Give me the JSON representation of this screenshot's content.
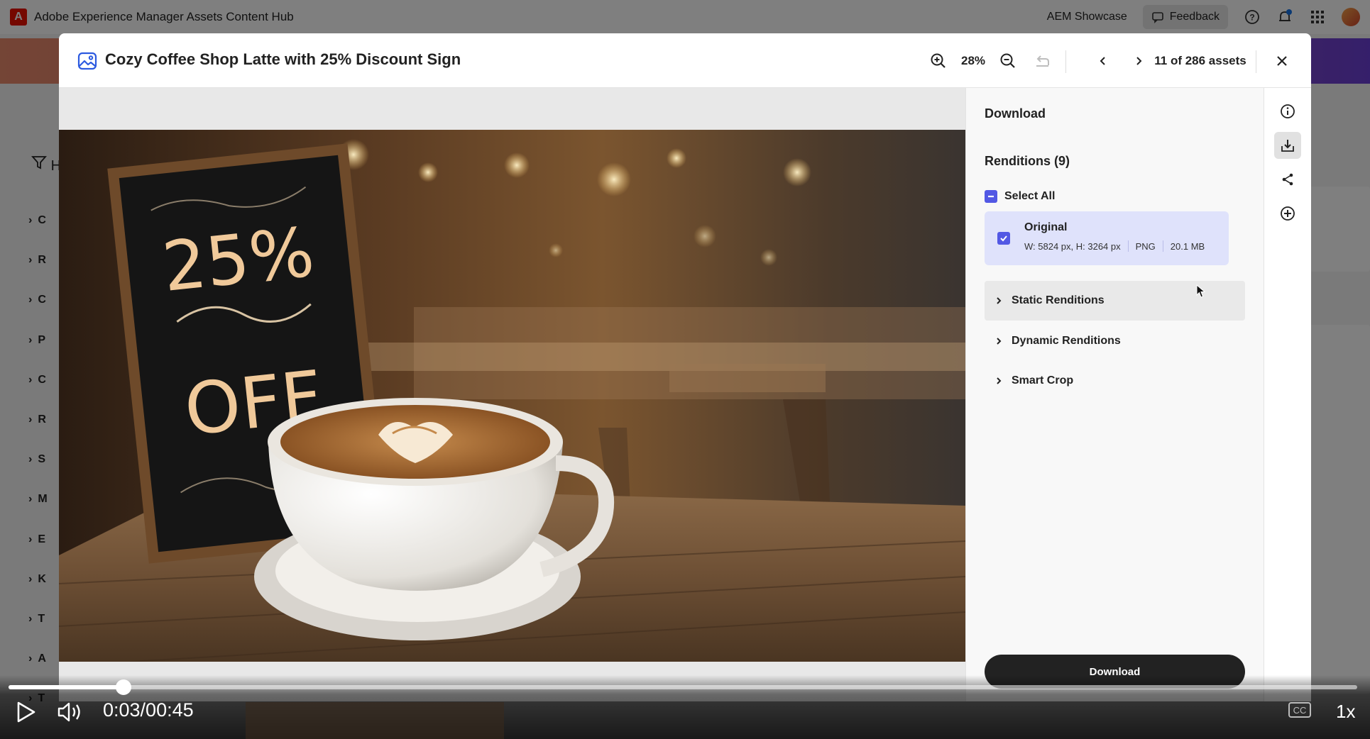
{
  "app": {
    "title": "Adobe Experience Manager Assets Content Hub",
    "logo_letter": "A",
    "showcase": "AEM Showcase",
    "feedback": "Feedback"
  },
  "background": {
    "filter_letter": "H",
    "list_letters": [
      "C",
      "R",
      "C",
      "P",
      "C",
      "R",
      "S",
      "M",
      "E",
      "K",
      "T",
      "A",
      "T"
    ]
  },
  "modal": {
    "title": "Cozy Coffee Shop Latte with 25% Discount Sign",
    "zoom": "28%",
    "counter": "11 of 286 assets"
  },
  "photo": {
    "sign_line1": "25%",
    "sign_line2": "OFF"
  },
  "panel": {
    "heading": "Download",
    "renditions_title": "Renditions (9)",
    "select_all": "Select All",
    "original": {
      "name": "Original",
      "dimensions": "W: 5824 px, H: 3264 px",
      "format": "PNG",
      "size": "20.1 MB"
    },
    "sections": [
      "Static Renditions",
      "Dynamic Renditions",
      "Smart Crop"
    ],
    "download_button": "Download"
  },
  "video": {
    "time": "0:03/00:45",
    "speed": "1x",
    "progress": 0.085,
    "cc": "CC"
  }
}
